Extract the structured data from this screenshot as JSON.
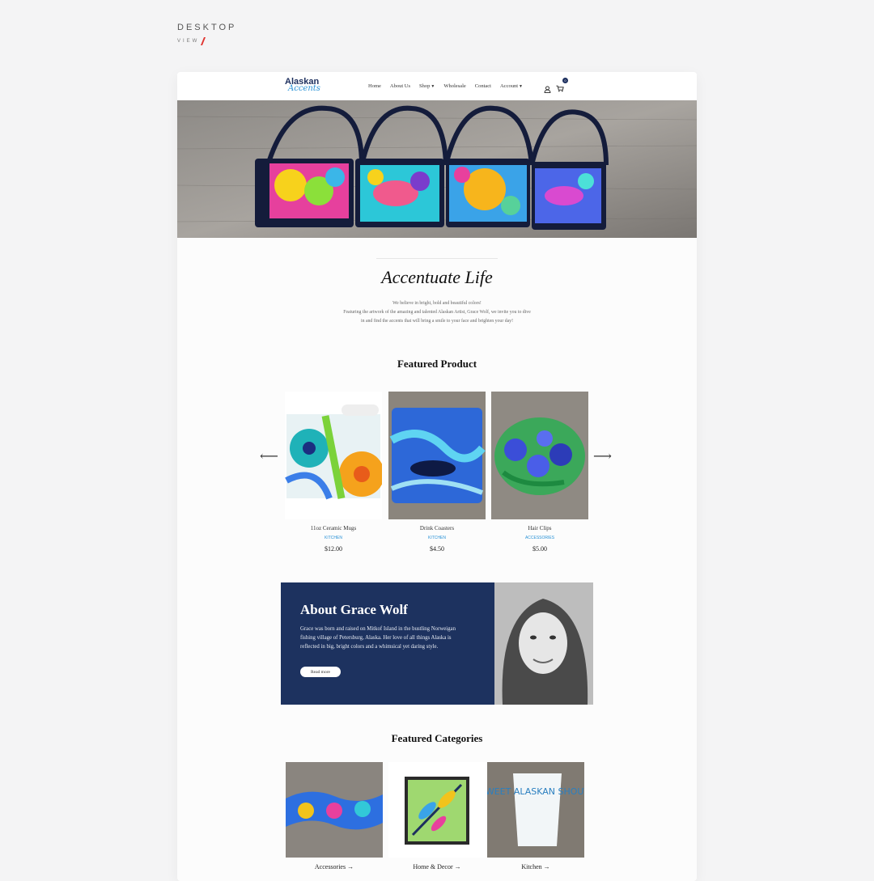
{
  "view_label": {
    "title": "DESKTOP",
    "sub": "VIEW"
  },
  "nav": {
    "logo_main": "Alaskan",
    "logo_sub": "Accents",
    "items": [
      "Home",
      "About Us",
      "Shop",
      "Wholesale",
      "Contact",
      "Account"
    ],
    "cart_count": "0"
  },
  "intro": {
    "title": "Accentuate Life",
    "line1": "We believe in bright, bold and beautiful colors!",
    "line2": "Featuring the artwork of the amazing and talented Alaskan Artist, Grace Wolf, we invite you to dive",
    "line3": "in and find the accents that will bring a smile to your face and brighten your day!"
  },
  "featured": {
    "title": "Featured Product",
    "products": [
      {
        "name": "11oz Ceramic Mugs",
        "category": "KITCHEN",
        "price": "$12.00"
      },
      {
        "name": "Drink Coasters",
        "category": "KITCHEN",
        "price": "$4.50"
      },
      {
        "name": "Hair Clips",
        "category": "ACCESSORIES",
        "price": "$5.00"
      }
    ]
  },
  "about": {
    "title": "About Grace Wolf",
    "body": "Grace was born and raised on Mitkof Island in the bustling Norweigan fishing village of Petersburg, Alaska. Her love of all things Alaska is reflected in big, bright colors and a whimsical yet daring style.",
    "button": "Read more"
  },
  "categories": {
    "title": "Featured Categories",
    "items": [
      "Accessories →",
      "Home & Decor →",
      "Kitchen →"
    ]
  },
  "mug_text": "SWEET ALASKAN SHOUTS",
  "colors": {
    "navy": "#1d325f",
    "accent_blue": "#2a92d6",
    "red": "#e0332f"
  }
}
